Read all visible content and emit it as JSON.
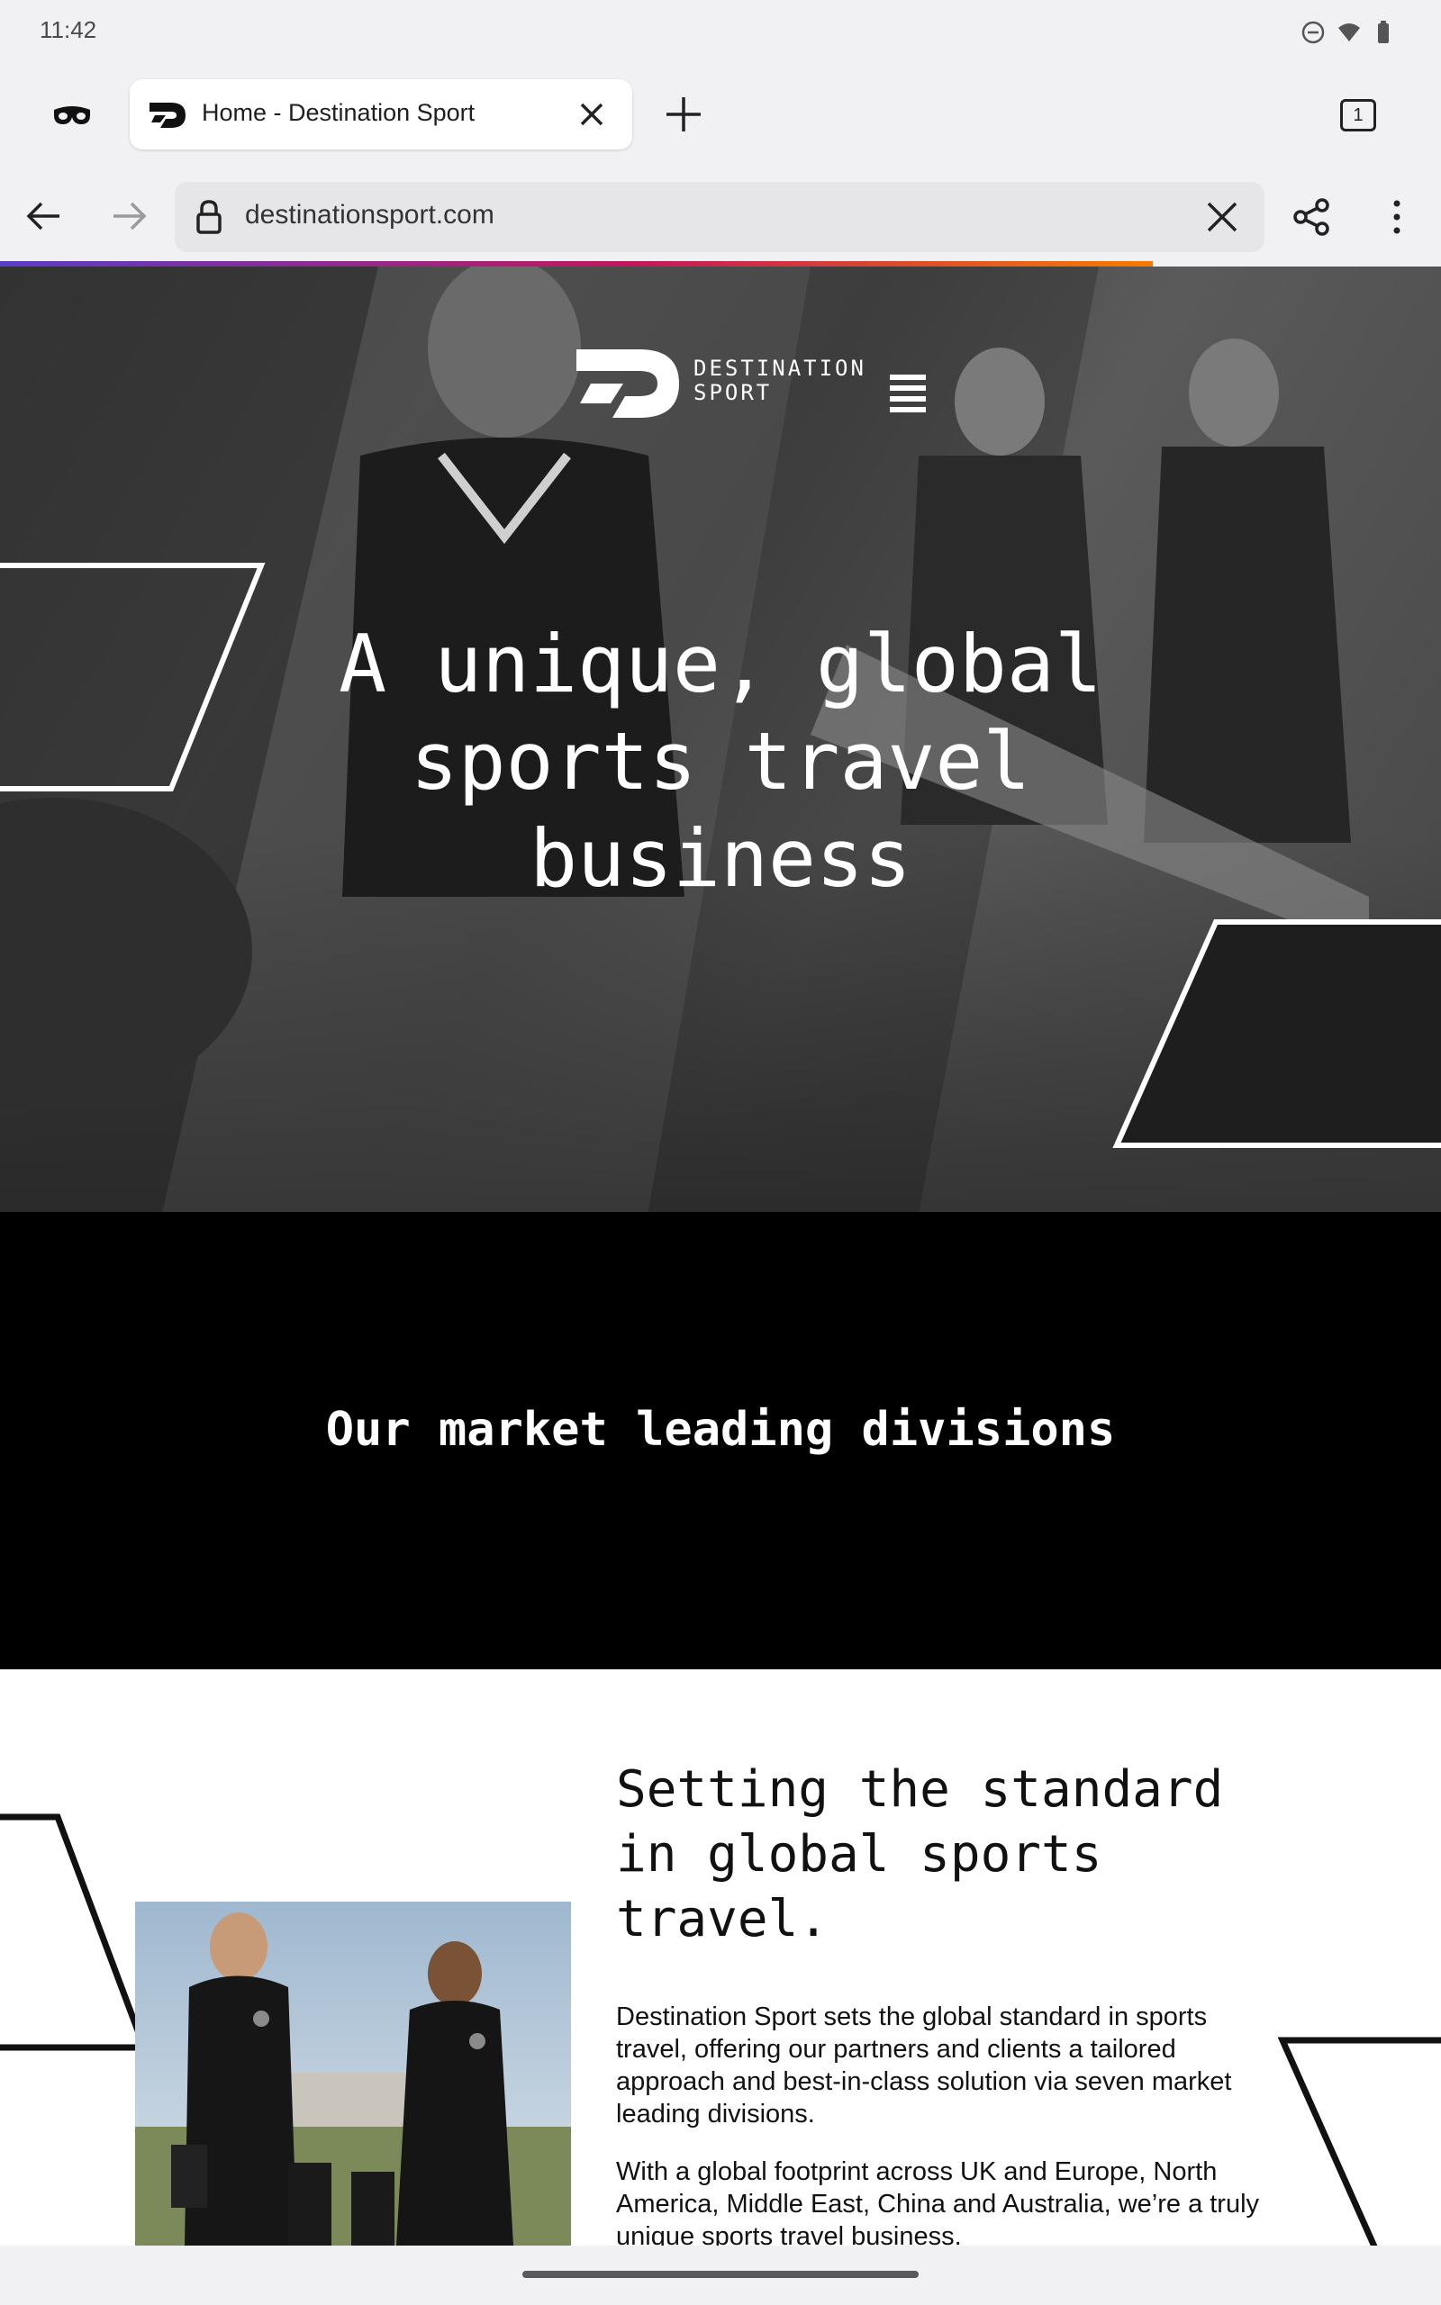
{
  "status_bar": {
    "time": "11:42",
    "icons": [
      "do-not-disturb-icon",
      "wifi-icon",
      "battery-icon"
    ]
  },
  "browser": {
    "tab": {
      "title": "Home - Destination Sport"
    },
    "tab_count": "1",
    "url": "destinationsport.com"
  },
  "hero": {
    "logo_line1": "DESTINATION",
    "logo_line2": "SPORT",
    "title_line1": "A unique, global",
    "title_line2": "sports travel",
    "title_line3": "business"
  },
  "divisions": {
    "heading": "Our market leading divisions"
  },
  "standard": {
    "heading_line1": "Setting the standard",
    "heading_line2": "in global sports",
    "heading_line3": "travel.",
    "paragraph1": "Destination Sport sets the global standard in sports travel, offering our partners and clients a tailored approach and best-in-class solution via seven market leading divisions.",
    "paragraph2": "With a global footprint across UK and Europe, North America, Middle East, China and Australia, we’re a truly unique sports travel business."
  },
  "colors": {
    "brand_black": "#000000",
    "page_white": "#ffffff",
    "chrome_bg": "#f1f1f3"
  }
}
